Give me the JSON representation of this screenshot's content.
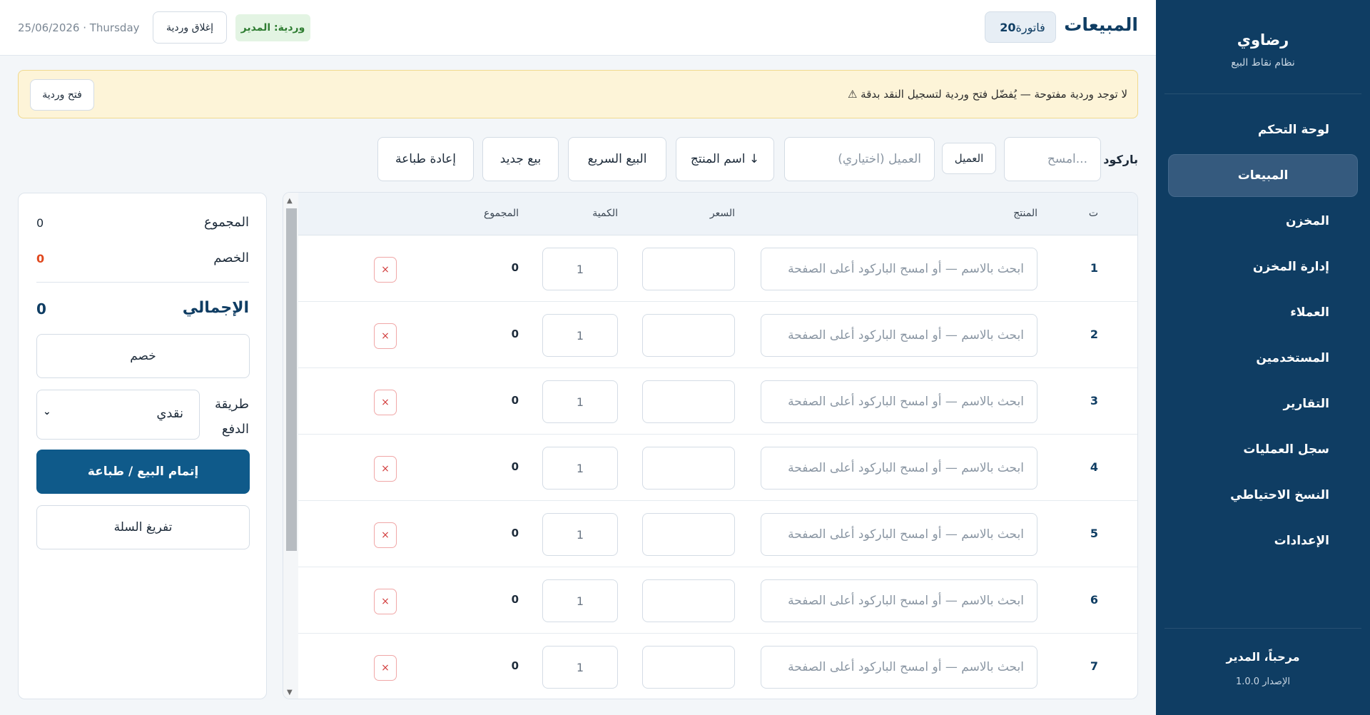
{
  "sidebar": {
    "brand_name": "رضاوي",
    "brand_sub": "نظام نقاط البيع",
    "items": [
      {
        "label": "لوحة التحكم",
        "active": false
      },
      {
        "label": "المبيعات",
        "active": true
      },
      {
        "label": "المخزن",
        "active": false
      },
      {
        "label": "إدارة المخزن",
        "active": false
      },
      {
        "label": "العملاء",
        "active": false
      },
      {
        "label": "المستخدمين",
        "active": false
      },
      {
        "label": "التقارير",
        "active": false
      },
      {
        "label": "سجل العمليات",
        "active": false
      },
      {
        "label": "النسخ الاحتياطي",
        "active": false
      },
      {
        "label": "الإعدادات",
        "active": false
      }
    ],
    "welcome": "مرحباً، المدير",
    "version": "الإصدار 1.0.0"
  },
  "header": {
    "title": "المبيعات",
    "invoice_label": "فاتورة",
    "invoice_number": "20",
    "shift_badge": "وردية: المدير",
    "close_shift": "إغلاق وردية",
    "date": "25/06/2026 · Thursday"
  },
  "alert": {
    "text": "⚠ لا توجد وردية مفتوحة — يُفضّل فتح وردية لتسجيل النقد بدقة",
    "open_shift": "فتح وردية"
  },
  "toolbar": {
    "barcode_label": "باركود",
    "barcode_placeholder": "امسح...",
    "customer_button": "العميل",
    "customer_placeholder": "العميل (اختياري)",
    "product_name_button": "اسم المنتج ↓",
    "quick_sale": "البيع السريع",
    "new_sale": "بيع جديد",
    "reprint": "إعادة طباعة"
  },
  "table": {
    "headers": {
      "num": "ت",
      "product": "المنتج",
      "price": "السعر",
      "qty": "الكمية",
      "total": "المجموع"
    },
    "product_placeholder": "ابحث بالاسم — أو امسح الباركود أعلى الصفحة",
    "delete_symbol": "×",
    "rows": [
      {
        "num": "1",
        "qty": "1",
        "total": "0"
      },
      {
        "num": "2",
        "qty": "1",
        "total": "0"
      },
      {
        "num": "3",
        "qty": "1",
        "total": "0"
      },
      {
        "num": "4",
        "qty": "1",
        "total": "0"
      },
      {
        "num": "5",
        "qty": "1",
        "total": "0"
      },
      {
        "num": "6",
        "qty": "1",
        "total": "0"
      },
      {
        "num": "7",
        "qty": "1",
        "total": "0"
      }
    ]
  },
  "summary": {
    "subtotal_label": "المجموع",
    "subtotal_value": "0",
    "discount_label": "الخصم",
    "discount_value": "0",
    "total_label": "الإجمالي",
    "total_value": "0",
    "discount_button": "خصم",
    "payment_label": "طريقة الدفع",
    "payment_value": "نقدي",
    "complete_button": "إتمام البيع / طباعة",
    "clear_button": "تفريغ السلة"
  },
  "colors": {
    "sidebar_bg": "#0f3d63",
    "primary": "#0f5a8a",
    "alert_bg": "#fdf4d8",
    "discount_red": "#e0491f",
    "shift_green": "#2f7d32"
  }
}
